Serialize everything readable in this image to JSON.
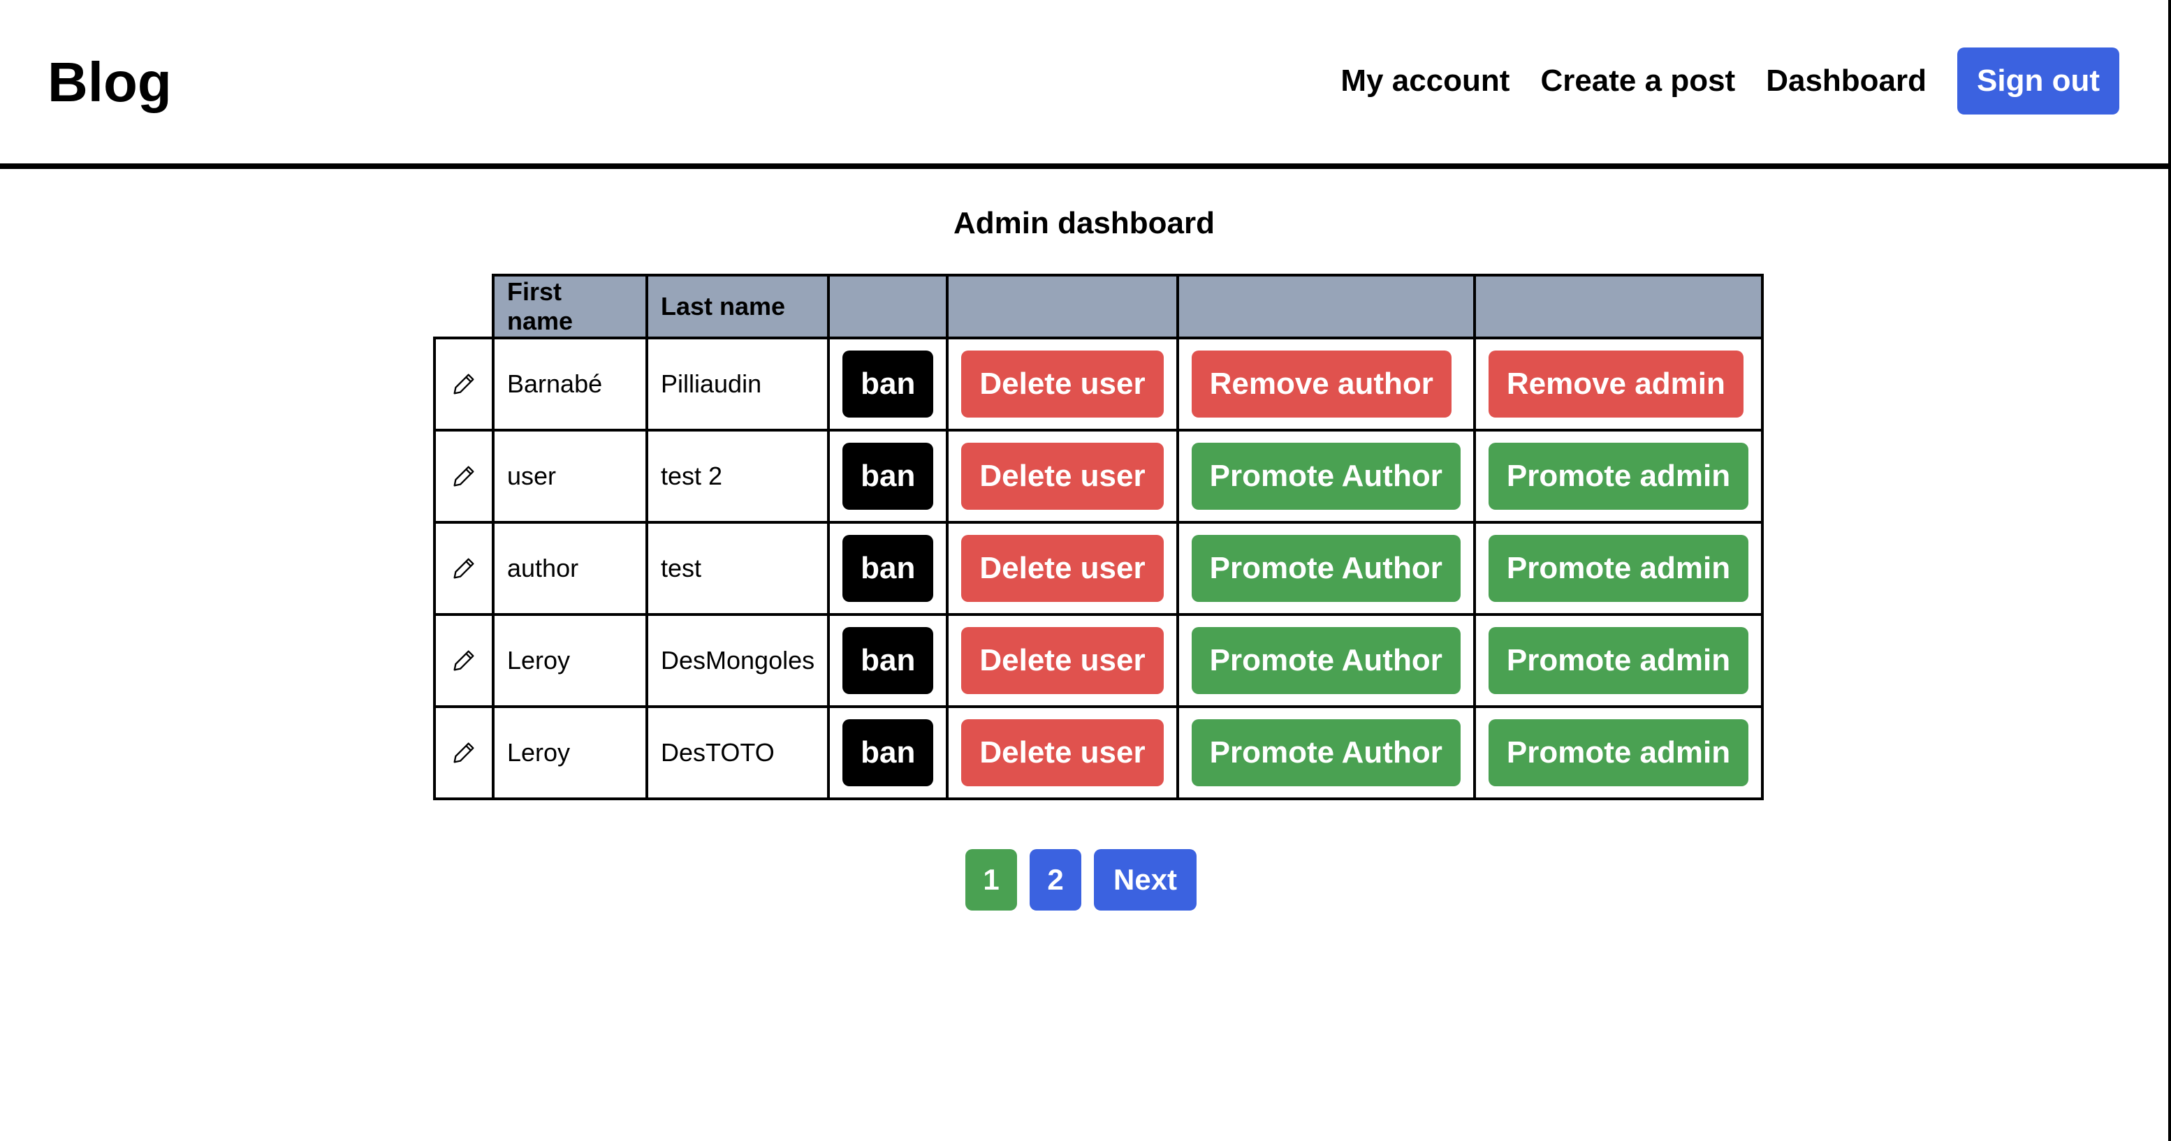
{
  "header": {
    "brand": "Blog",
    "nav": [
      "My account",
      "Create a post",
      "Dashboard"
    ],
    "signout_label": "Sign out"
  },
  "title": "Admin dashboard",
  "table": {
    "headers": [
      "First name",
      "Last name",
      "",
      "",
      "",
      ""
    ],
    "rows": [
      {
        "first": "Barnabé",
        "last": "Pilliaudin",
        "ban": "ban",
        "delete": "Delete user",
        "author_action": "Remove author",
        "admin_action": "Remove admin"
      },
      {
        "first": "user",
        "last": "test 2",
        "ban": "ban",
        "delete": "Delete user",
        "author_action": "Promote Author",
        "admin_action": "Promote admin"
      },
      {
        "first": "author",
        "last": "test",
        "ban": "ban",
        "delete": "Delete user",
        "author_action": "Promote Author",
        "admin_action": "Promote admin"
      },
      {
        "first": "Leroy",
        "last": "DesMongoles",
        "ban": "ban",
        "delete": "Delete user",
        "author_action": "Promote Author",
        "admin_action": "Promote admin"
      },
      {
        "first": "Leroy",
        "last": "DesTOTO",
        "ban": "ban",
        "delete": "Delete user",
        "author_action": "Promote Author",
        "admin_action": "Promote admin"
      }
    ]
  },
  "pagination": {
    "pages": [
      "1",
      "2"
    ],
    "current": "1",
    "next_label": "Next"
  },
  "colors": {
    "primary": "#3b62e0",
    "danger": "#e0524e",
    "success": "#4aa152",
    "header_bg": "#97a4b8"
  },
  "icons": {
    "edit": "pencil-icon"
  }
}
